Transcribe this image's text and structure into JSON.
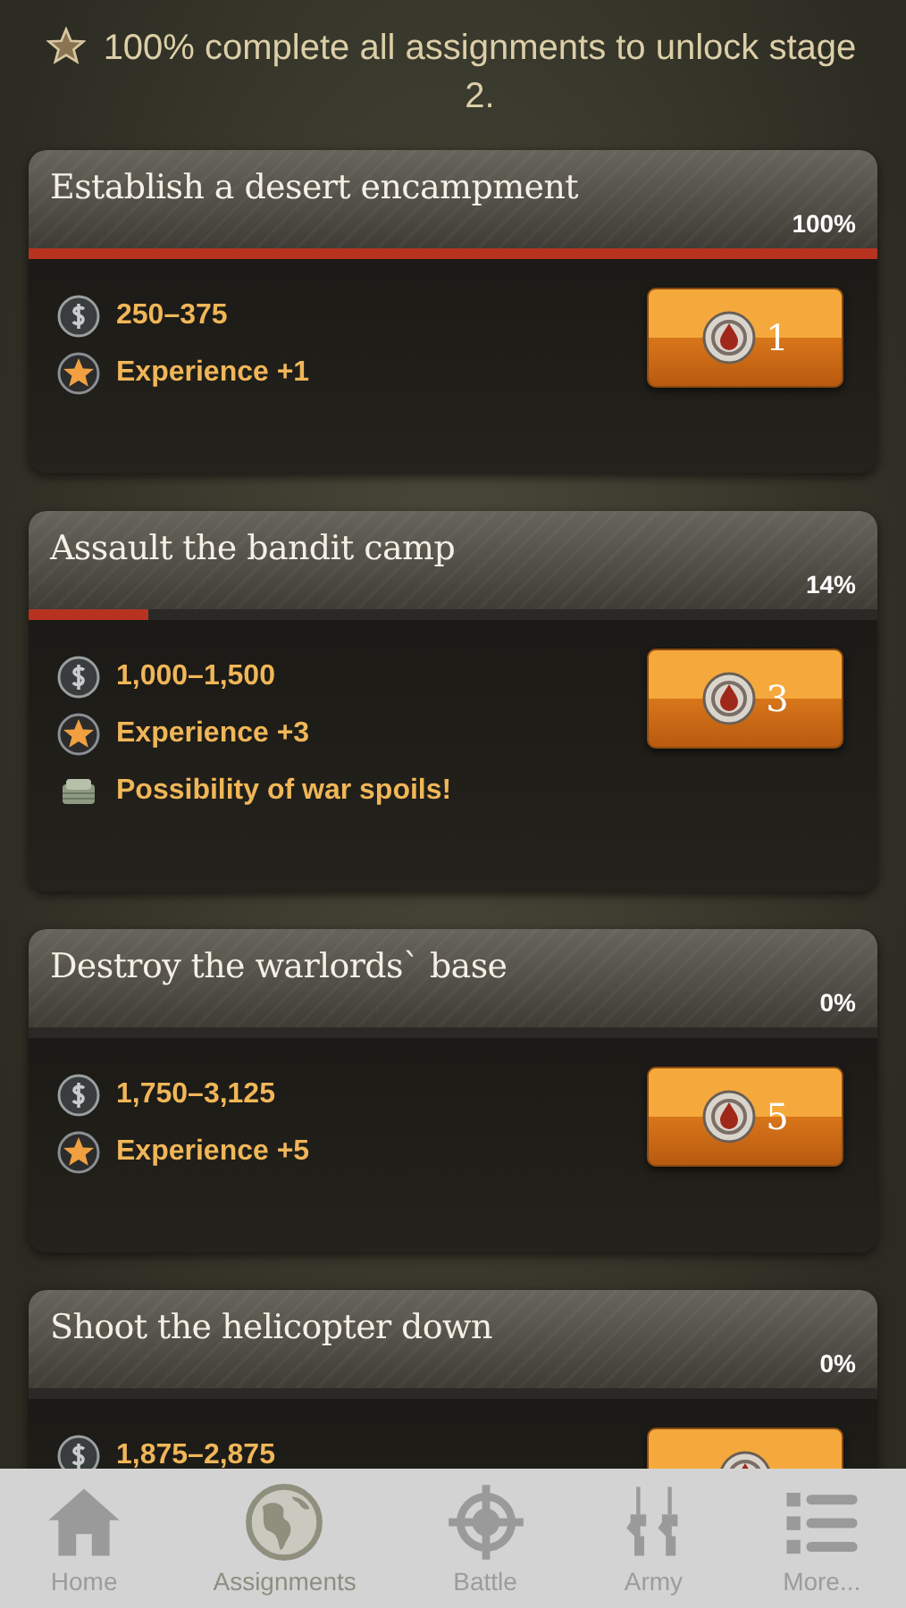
{
  "notice": {
    "text": "100% complete all assignments to unlock stage 2."
  },
  "assignments": [
    {
      "title": "Establish a desert encampment",
      "percent": "100%",
      "level": 1.0,
      "rewards": [
        {
          "kind": "money",
          "text": "250–375"
        },
        {
          "kind": "experience",
          "text": "Experience +1"
        }
      ],
      "cost": "1"
    },
    {
      "title": "Assault the bandit camp",
      "percent": "14%",
      "level": 0.14,
      "rewards": [
        {
          "kind": "money",
          "text": "1,000–1,500"
        },
        {
          "kind": "experience",
          "text": "Experience +3"
        },
        {
          "kind": "spoils",
          "text": "Possibility of war spoils!"
        }
      ],
      "cost": "3"
    },
    {
      "title": "Destroy the warlords` base",
      "percent": "0%",
      "level": 0.0,
      "rewards": [
        {
          "kind": "money",
          "text": "1,750–3,125"
        },
        {
          "kind": "experience",
          "text": "Experience +5"
        }
      ],
      "cost": "5"
    },
    {
      "title": "Shoot the helicopter down",
      "percent": "0%",
      "level": 0.0,
      "rewards": [
        {
          "kind": "money",
          "text": "1,875–2,875"
        }
      ]
    }
  ],
  "tab_bar": [
    {
      "kind": "home",
      "label": "Home",
      "selected": false
    },
    {
      "kind": "globe",
      "label": "Assignments",
      "selected": true
    },
    {
      "kind": "target",
      "label": "Battle",
      "selected": false
    },
    {
      "kind": "army",
      "label": "Army",
      "selected": false
    },
    {
      "kind": "more",
      "label": "More...",
      "selected": false
    }
  ]
}
